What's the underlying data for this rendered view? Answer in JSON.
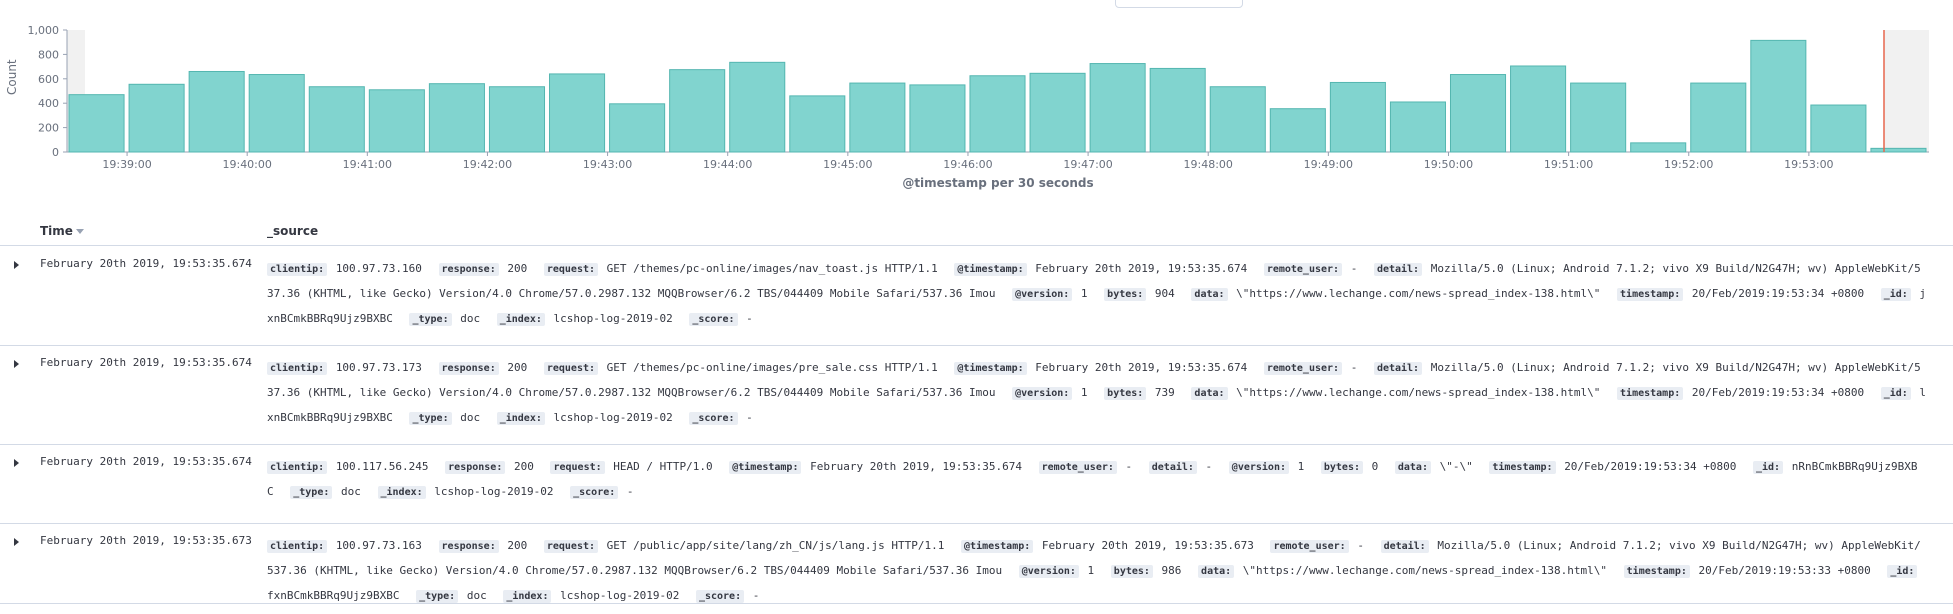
{
  "chart_data": {
    "type": "bar",
    "ylabel": "Count",
    "xlabel": "@timestamp per 30 seconds",
    "ylim": [
      0,
      1000
    ],
    "yticks": [
      "0",
      "200",
      "400",
      "600",
      "800",
      "1,000"
    ],
    "xticks": [
      "19:39:00",
      "19:40:00",
      "19:41:00",
      "19:42:00",
      "19:43:00",
      "19:44:00",
      "19:45:00",
      "19:46:00",
      "19:47:00",
      "19:48:00",
      "19:49:00",
      "19:50:00",
      "19:51:00",
      "19:52:00",
      "19:53:00"
    ],
    "values": [
      470,
      555,
      660,
      635,
      535,
      510,
      560,
      535,
      640,
      395,
      675,
      735,
      460,
      565,
      550,
      625,
      645,
      725,
      685,
      535,
      355,
      570,
      410,
      635,
      705,
      565,
      75,
      565,
      915,
      385,
      30
    ],
    "bar_color": "#81d4cf",
    "bar_stroke": "#54b6b0",
    "marker_color": "#e7664c"
  },
  "table": {
    "col_time": "Time",
    "col_source": "_source"
  },
  "rows": [
    {
      "time": "February 20th 2019, 19:53:35.674",
      "fields": [
        {
          "k": "clientip:",
          "v": "100.97.73.160"
        },
        {
          "k": "response:",
          "v": "200"
        },
        {
          "k": "request:",
          "v": "GET /themes/pc-online/images/nav_toast.js HTTP/1.1"
        },
        {
          "k": "@timestamp:",
          "v": "February 20th 2019, 19:53:35.674"
        },
        {
          "k": "remote_user:",
          "v": "-"
        },
        {
          "k": "detail:",
          "v": "Mozilla/5.0 (Linux; Android 7.1.2; vivo X9 Build/N2G47H; wv) AppleWebKit/537.36 (KHTML, like Gecko) Version/4.0 Chrome/57.0.2987.132 MQQBrowser/6.2 TBS/044409 Mobile Safari/537.36 Imou"
        },
        {
          "k": "@version:",
          "v": "1"
        },
        {
          "k": "bytes:",
          "v": "904"
        },
        {
          "k": "data:",
          "v": "\\\"https://www.lechange.com/news-spread_index-138.html\\\""
        },
        {
          "k": "timestamp:",
          "v": "20/Feb/2019:19:53:34 +0800"
        },
        {
          "k": "_id:",
          "v": "jxnBCmkBBRq9Ujz9BXBC"
        },
        {
          "k": "_type:",
          "v": "doc"
        },
        {
          "k": "_index:",
          "v": "lcshop-log-2019-02"
        },
        {
          "k": "_score:",
          "v": "-"
        }
      ]
    },
    {
      "time": "February 20th 2019, 19:53:35.674",
      "fields": [
        {
          "k": "clientip:",
          "v": "100.97.73.173"
        },
        {
          "k": "response:",
          "v": "200"
        },
        {
          "k": "request:",
          "v": "GET /themes/pc-online/images/pre_sale.css HTTP/1.1"
        },
        {
          "k": "@timestamp:",
          "v": "February 20th 2019, 19:53:35.674"
        },
        {
          "k": "remote_user:",
          "v": "-"
        },
        {
          "k": "detail:",
          "v": "Mozilla/5.0 (Linux; Android 7.1.2; vivo X9 Build/N2G47H; wv) AppleWebKit/537.36 (KHTML, like Gecko) Version/4.0 Chrome/57.0.2987.132 MQQBrowser/6.2 TBS/044409 Mobile Safari/537.36 Imou"
        },
        {
          "k": "@version:",
          "v": "1"
        },
        {
          "k": "bytes:",
          "v": "739"
        },
        {
          "k": "data:",
          "v": "\\\"https://www.lechange.com/news-spread_index-138.html\\\""
        },
        {
          "k": "timestamp:",
          "v": "20/Feb/2019:19:53:34 +0800"
        },
        {
          "k": "_id:",
          "v": "lxnBCmkBBRq9Ujz9BXBC"
        },
        {
          "k": "_type:",
          "v": "doc"
        },
        {
          "k": "_index:",
          "v": "lcshop-log-2019-02"
        },
        {
          "k": "_score:",
          "v": "-"
        }
      ]
    },
    {
      "time": "February 20th 2019, 19:53:35.674",
      "fields": [
        {
          "k": "clientip:",
          "v": "100.117.56.245"
        },
        {
          "k": "response:",
          "v": "200"
        },
        {
          "k": "request:",
          "v": "HEAD / HTTP/1.0"
        },
        {
          "k": "@timestamp:",
          "v": "February 20th 2019, 19:53:35.674"
        },
        {
          "k": "remote_user:",
          "v": "-"
        },
        {
          "k": "detail:",
          "v": "-"
        },
        {
          "k": "@version:",
          "v": "1"
        },
        {
          "k": "bytes:",
          "v": "0"
        },
        {
          "k": "data:",
          "v": "\\\"-\\\""
        },
        {
          "k": "timestamp:",
          "v": "20/Feb/2019:19:53:34 +0800"
        },
        {
          "k": "_id:",
          "v": "nRnBCmkBBRq9Ujz9BXBC"
        },
        {
          "k": "_type:",
          "v": "doc"
        },
        {
          "k": "_index:",
          "v": "lcshop-log-2019-02"
        },
        {
          "k": "_score:",
          "v": "-"
        }
      ]
    },
    {
      "time": "February 20th 2019, 19:53:35.673",
      "fields": [
        {
          "k": "clientip:",
          "v": "100.97.73.163"
        },
        {
          "k": "response:",
          "v": "200"
        },
        {
          "k": "request:",
          "v": "GET /public/app/site/lang/zh_CN/js/lang.js HTTP/1.1"
        },
        {
          "k": "@timestamp:",
          "v": "February 20th 2019, 19:53:35.673"
        },
        {
          "k": "remote_user:",
          "v": "-"
        },
        {
          "k": "detail:",
          "v": "Mozilla/5.0 (Linux; Android 7.1.2; vivo X9 Build/N2G47H; wv) AppleWebKit/537.36 (KHTML, like Gecko) Version/4.0 Chrome/57.0.2987.132 MQQBrowser/6.2 TBS/044409 Mobile Safari/537.36 Imou"
        },
        {
          "k": "@version:",
          "v": "1"
        },
        {
          "k": "bytes:",
          "v": "986"
        },
        {
          "k": "data:",
          "v": "\\\"https://www.lechange.com/news-spread_index-138.html\\\""
        },
        {
          "k": "timestamp:",
          "v": "20/Feb/2019:19:53:33 +0800"
        },
        {
          "k": "_id:",
          "v": "fxnBCmkBBRq9Ujz9BXBC"
        },
        {
          "k": "_type:",
          "v": "doc"
        },
        {
          "k": "_index:",
          "v": "lcshop-log-2019-02"
        },
        {
          "k": "_score:",
          "v": "-"
        }
      ]
    }
  ]
}
